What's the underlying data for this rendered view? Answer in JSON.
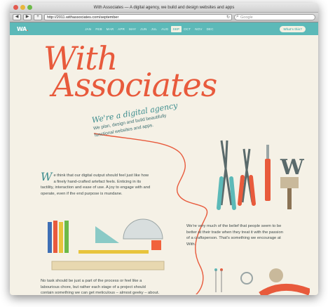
{
  "window": {
    "title": "With Associates — A digital agency, we build and design websites and apps",
    "url": "http://2011.withassociates.com/september",
    "search_placeholder": "Google"
  },
  "site": {
    "logo_text": "WA",
    "months": [
      "JAN",
      "FEB",
      "MAR",
      "APR",
      "MAY",
      "JUN",
      "JUL",
      "AUG",
      "SEP",
      "OCT",
      "NOV",
      "DEC"
    ],
    "active_month": "SEP",
    "whats_this": "What's this?"
  },
  "hero": {
    "line1": "With",
    "line2": "Associates",
    "tagline_head": "We're a digital agency",
    "tagline_sub1": "We plan, design and build beautifully",
    "tagline_sub2": "functional websites and apps."
  },
  "body": {
    "p1_cap": "W",
    "p1": "e think that our digital output should feel just like how a finely hand-crafted artefact feels. Enticing in its tactility, interaction and ease of use. A joy to engage with and operate, even if the end purpose is mundane.",
    "p2": "We're very much of the belief that people seem to be better at their trade when they treat it with the passion of a craftsperson. That's something we encourage at With.",
    "p3": "No task should be just a part of the process or feel like a labourious chore, but rather each stage of a project should contain something we can get meticulous – almost geeky – about. We take pleasure in the process of creating our projects, and we think it shows in the final product."
  },
  "colors": {
    "teal": "#5cb9b8",
    "orange": "#e85a3c",
    "paper": "#f5f1e6"
  }
}
